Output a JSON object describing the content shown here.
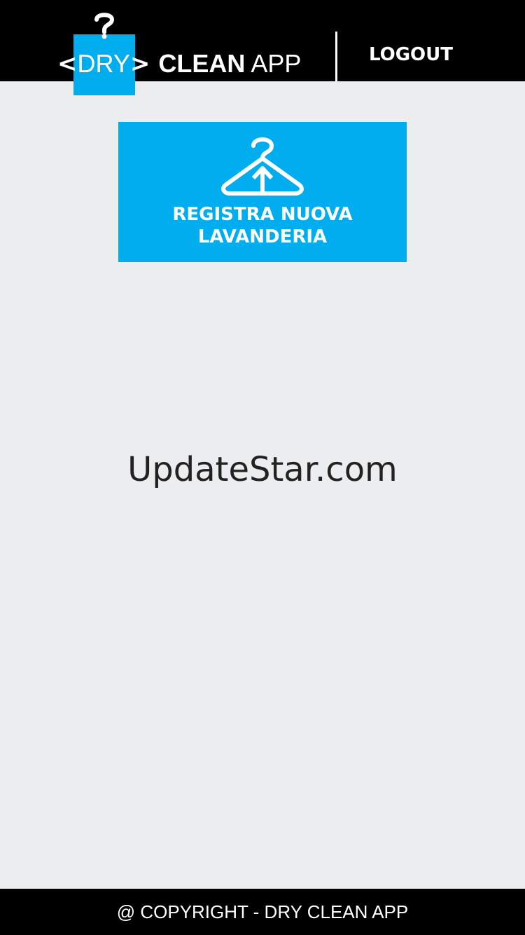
{
  "header": {
    "logo": {
      "left_chevron": "<",
      "dry": "DRY",
      "right_chevron": ">",
      "clean": "CLEAN",
      "app": "APP"
    },
    "logout_label": "LOGOUT"
  },
  "main": {
    "register_button": {
      "line1": "REGISTRA NUOVA",
      "line2": "LAVANDERIA",
      "icon": "hanger-upload-icon"
    },
    "watermark": "UpdateStar.com"
  },
  "footer": {
    "copyright": "@ COPYRIGHT - DRY CLEAN APP"
  },
  "colors": {
    "brand_blue": "#00aeef",
    "header_bg": "#000000",
    "page_bg": "#ecedef"
  }
}
